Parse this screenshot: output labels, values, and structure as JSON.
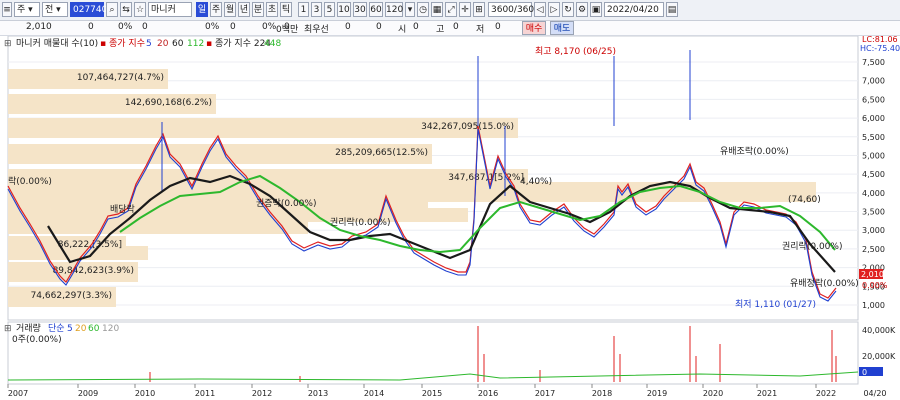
{
  "toolbar": {
    "market": "주",
    "period_select": "전",
    "stock_code": "027740",
    "stock_name": "마니커",
    "selected_period": "일",
    "periods": [
      "일",
      "주",
      "월",
      "년",
      "분",
      "초",
      "틱"
    ],
    "intervals": [
      "1",
      "3",
      "5",
      "10",
      "30",
      "60",
      "120"
    ],
    "count": "3600",
    "count_max": "/3600",
    "date": "2022/04/20"
  },
  "info": {
    "price": "2,010",
    "change": "0",
    "pct": "0%",
    "v1": "0",
    "pct2": "0%",
    "v2": "0",
    "pct3": "0%",
    "v3": "0",
    "volume": "0백만",
    "best_label": "최우선",
    "best1": "0",
    "best2": "0",
    "si": "시",
    "si_v": "0",
    "go": "고",
    "go_v": "0",
    "jeo": "저",
    "jeo_v": "0",
    "buy": "매수",
    "sell": "매도"
  },
  "legend": {
    "title": "마니커 매물대 수(10)",
    "close": "종가 지수",
    "ma": [
      "5",
      "20",
      "60",
      "112"
    ],
    "close2": "종가 지수 224",
    "ma448": "448"
  },
  "lc": "LC:81.06",
  "hc": "HC:-75.40",
  "price_ticks": [
    "7,500",
    "7,000",
    "6,500",
    "6,000",
    "5,500",
    "5,000",
    "4,500",
    "4,000",
    "3,500",
    "3,000",
    "2,500",
    "2,000",
    "1,500",
    "1,000"
  ],
  "volume_profile": [
    {
      "label": "107,464,727(4.7%)"
    },
    {
      "label": "142,690,168(6.2%)"
    },
    {
      "label": "342,267,095(15.0%)"
    },
    {
      "label": "285,209,665(12.5%)"
    },
    {
      "label": "347,687,1[5.2%]"
    },
    {
      "label": "86,222,[3.5%]"
    },
    {
      "label": "89,842,623(3.9%)"
    },
    {
      "label": "74,662,297(3.3%)"
    }
  ],
  "annotations": {
    "max": "최고 8,170 (06/25)",
    "min": "최저 1,110 (01/27)",
    "start": "락(0.00%)",
    "dividend": "배당락",
    "rights": "권증락(0.00%)",
    "rights2": "권리락(0.00%)",
    "right_side": "권리락(0.00%)",
    "r2": "유배조락(0.00%)",
    "mid": "(74,60)",
    "r3": "4,40%)",
    "r4": "유배정락(0.00%)"
  },
  "last_price": "2,010",
  "last_pct": "0.00%",
  "volume_panel": {
    "title": "거래량",
    "simple": "단순",
    "ma": [
      "5",
      "20",
      "60",
      "120"
    ],
    "value": "0주(0.00%)",
    "ticks": [
      "40,000K",
      "20,000K",
      "0"
    ],
    "last": "0"
  },
  "x_axis": [
    "2007",
    "2009",
    "2010",
    "2011",
    "2012",
    "2013",
    "2014",
    "2015",
    "2016",
    "2017",
    "2018",
    "2019",
    "2020",
    "2021",
    "2022",
    "04/20"
  ],
  "colors": {
    "price": "#e02020",
    "ma5": "#2040d0",
    "ma20": "#c02020",
    "ma60": "#1a1a1a",
    "ma112": "#2db82d",
    "profile": "#f5e4c8"
  }
}
